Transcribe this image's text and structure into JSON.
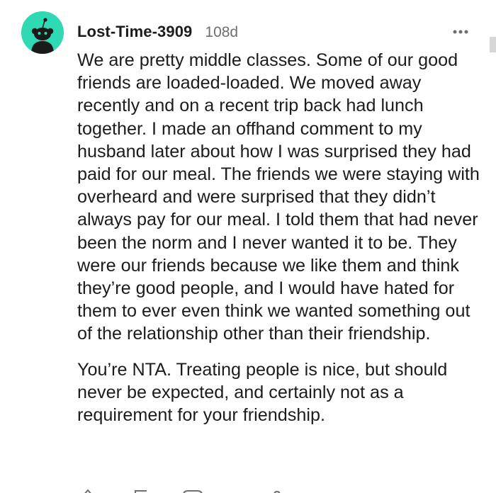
{
  "comment": {
    "username": "Lost-Time-3909",
    "age": "108d",
    "paragraphs": [
      "We are pretty middle classes. Some of our good friends are loaded-loaded. We moved away recently and on a recent trip back had lunch together. I made an offhand comment to my husband later about how I was surprised they had paid for our meal. The friends we were staying with overheard and were surprised that they didn’t always pay for our meal. I told them that had never been the norm and I never wanted it to be. They were our friends because we like them and think they’re good people, and I would have hated for them to ever even think we wanted something out of the relationship other than their friendship.",
      "You’re NTA. Treating people is nice, but should never be expected, and certainly not as a requirement for your friendship."
    ],
    "avatar_color": "#2fd9b3",
    "more_icon": "more-horizontal-icon",
    "action_icons": [
      "upvote-icon",
      "reply-icon",
      "award-icon",
      "share-icon"
    ]
  }
}
